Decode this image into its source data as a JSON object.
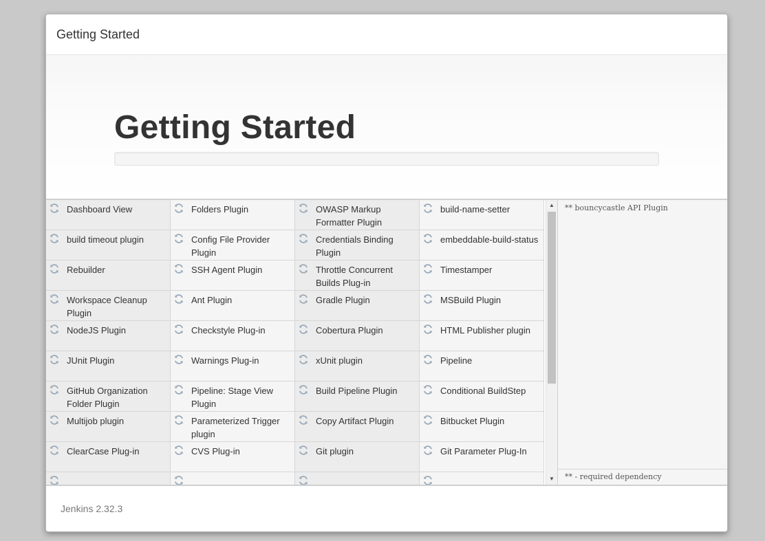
{
  "header": {
    "title": "Getting Started"
  },
  "hero": {
    "title": "Getting Started",
    "progress": 0
  },
  "plugins": [
    "Dashboard View",
    "Folders Plugin",
    "OWASP Markup Formatter Plugin",
    "build-name-setter",
    "build timeout plugin",
    "Config File Provider Plugin",
    "Credentials Binding Plugin",
    "embeddable-build-status",
    "Rebuilder",
    "SSH Agent Plugin",
    "Throttle Concurrent Builds Plug-in",
    "Timestamper",
    "Workspace Cleanup Plugin",
    "Ant Plugin",
    "Gradle Plugin",
    "MSBuild Plugin",
    "NodeJS Plugin",
    "Checkstyle Plug-in",
    "Cobertura Plugin",
    "HTML Publisher plugin",
    "JUnit Plugin",
    "Warnings Plug-in",
    "xUnit plugin",
    "Pipeline",
    "GitHub Organization Folder Plugin",
    "Pipeline: Stage View Plugin",
    "Build Pipeline Plugin",
    "Conditional BuildStep",
    "Multijob plugin",
    "Parameterized Trigger plugin",
    "Copy Artifact Plugin",
    "Bitbucket Plugin",
    "ClearCase Plug-in",
    "CVS Plug-in",
    "Git plugin",
    "Git Parameter Plug-In",
    "",
    "",
    "",
    ""
  ],
  "plugin_status_icon": "refresh-icon",
  "log": {
    "line": "** bouncycastle API Plugin",
    "footer": "** - required dependency"
  },
  "footer": {
    "version": "Jenkins 2.32.3"
  }
}
